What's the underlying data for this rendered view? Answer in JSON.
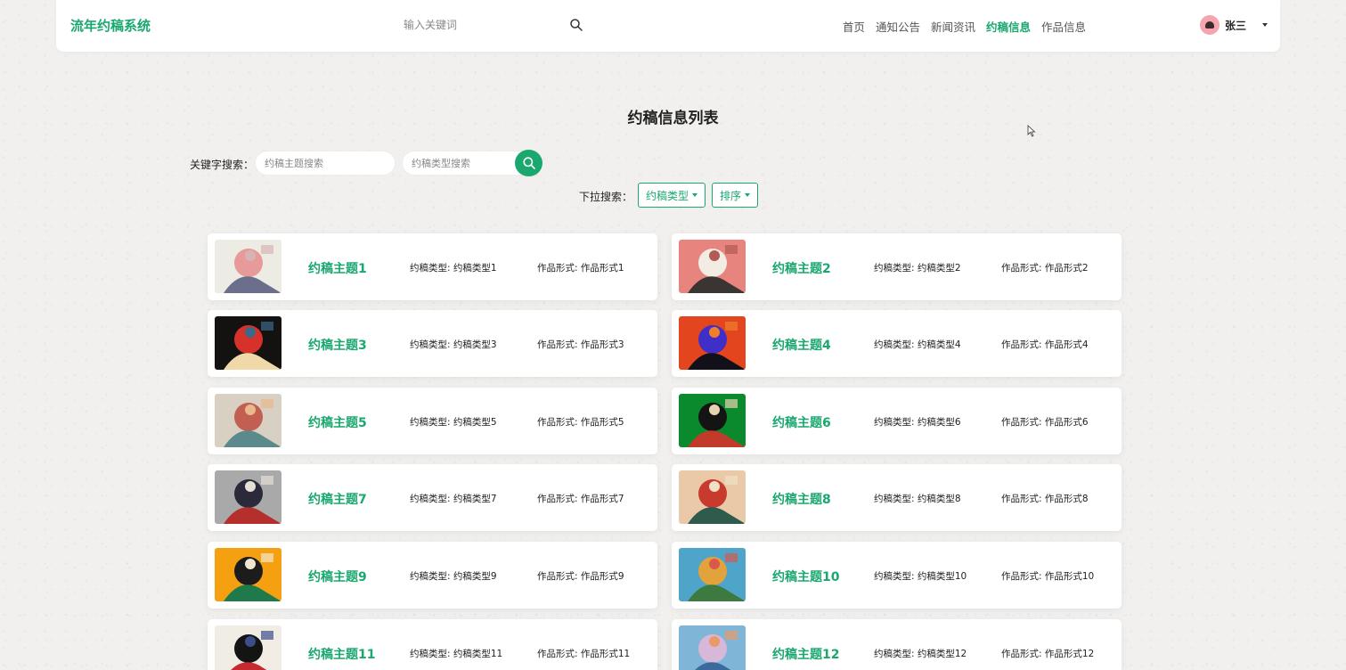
{
  "header": {
    "brand": "流年约稿系统",
    "search_placeholder": "输入关键词",
    "nav": [
      {
        "label": "首页",
        "active": false
      },
      {
        "label": "通知公告",
        "active": false
      },
      {
        "label": "新闻资讯",
        "active": false
      },
      {
        "label": "约稿信息",
        "active": true
      },
      {
        "label": "作品信息",
        "active": false
      }
    ],
    "user_name": "张三"
  },
  "page": {
    "title": "约稿信息列表",
    "keyword_label": "关键字搜索：",
    "topic_placeholder": "约稿主题搜索",
    "type_placeholder": "约稿类型搜索",
    "dropdown_label": "下拉搜索：",
    "type_dropdown": "约稿类型",
    "sort_dropdown": "排序"
  },
  "colors": {
    "accent": "#1aa86f"
  },
  "items": [
    {
      "title": "约稿主题1",
      "type": "约稿类型: 约稿类型1",
      "form": "作品形式: 作品形式1",
      "thumb": [
        "#ecebe4",
        "#e79a9a",
        "#6b6f8c",
        "#d8b3b3"
      ]
    },
    {
      "title": "约稿主题2",
      "type": "约稿类型: 约稿类型2",
      "form": "作品形式: 作品形式2",
      "thumb": [
        "#e8847e",
        "#f3ece3",
        "#3a3433",
        "#b45a55"
      ]
    },
    {
      "title": "约稿主题3",
      "type": "约稿类型: 约稿类型3",
      "form": "作品形式: 作品形式3",
      "thumb": [
        "#141211",
        "#d7312c",
        "#f0d9a8",
        "#3a6a8a"
      ]
    },
    {
      "title": "约稿主题4",
      "type": "约稿类型: 约稿类型4",
      "form": "作品形式: 作品形式4",
      "thumb": [
        "#e3461f",
        "#3f2ec8",
        "#121018",
        "#f07e2c"
      ]
    },
    {
      "title": "约稿主题5",
      "type": "约稿类型: 约稿类型5",
      "form": "作品形式: 作品形式5",
      "thumb": [
        "#d8d0c2",
        "#c25e52",
        "#5c8a8c",
        "#e8b98a"
      ]
    },
    {
      "title": "约稿主题6",
      "type": "约稿类型: 约稿类型6",
      "form": "作品形式: 作品形式6",
      "thumb": [
        "#0b8a2d",
        "#141414",
        "#c23a2a",
        "#e6d3b0"
      ]
    },
    {
      "title": "约稿主题7",
      "type": "约稿类型: 约稿类型7",
      "form": "作品形式: 作品形式7",
      "thumb": [
        "#a9a9a9",
        "#2a2a3a",
        "#b5302c",
        "#e6e0d5"
      ]
    },
    {
      "title": "约稿主题8",
      "type": "约稿类型: 约稿类型8",
      "form": "作品形式: 作品形式8",
      "thumb": [
        "#e9c9a8",
        "#c83a2e",
        "#2f5b4c",
        "#f0e0c5"
      ]
    },
    {
      "title": "约稿主题9",
      "type": "约稿类型: 约稿类型9",
      "form": "作品形式: 作品形式9",
      "thumb": [
        "#f5a011",
        "#1c1c1c",
        "#1f7a4b",
        "#f2e6d0"
      ]
    },
    {
      "title": "约稿主题10",
      "type": "约稿类型: 约稿类型10",
      "form": "作品形式: 作品形式10",
      "thumb": [
        "#4ea4c9",
        "#e3a23c",
        "#3c7a3f",
        "#d8584a"
      ]
    },
    {
      "title": "约稿主题11",
      "type": "约稿类型: 约稿类型11",
      "form": "作品形式: 作品形式11",
      "thumb": [
        "#f1ece4",
        "#141414",
        "#c72a2e",
        "#3a4e8a"
      ]
    },
    {
      "title": "约稿主题12",
      "type": "约稿类型: 约稿类型12",
      "form": "作品形式: 作品形式12",
      "thumb": [
        "#7fb6d8",
        "#d8b8d8",
        "#3b6a9c",
        "#e89a6a"
      ]
    }
  ]
}
